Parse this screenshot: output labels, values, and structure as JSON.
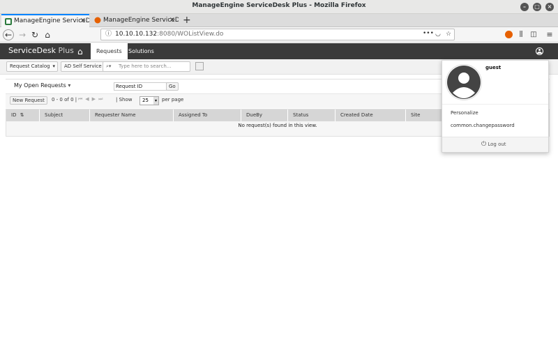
{
  "window": {
    "title": "ManageEngine ServiceDesk Plus - Mozilla Firefox"
  },
  "tabs": [
    {
      "label": "ManageEngine ServiceDe"
    },
    {
      "label": "ManageEngine ServiceDe"
    }
  ],
  "addressbar": {
    "host": "10.10.10.132",
    "path": ":8080/WOListView.do",
    "menu_dots": "•••"
  },
  "app": {
    "logo_main": "ServiceDesk",
    "logo_suffix": "Plus",
    "nav": [
      {
        "label": "Requests"
      },
      {
        "label": "Solutions"
      }
    ]
  },
  "toolbar": {
    "request_catalog": "Request Catalog",
    "ad_self_service": "AD Self Service",
    "search_placeholder": "Type here to search..."
  },
  "view": {
    "filter_label": "My Open Requests",
    "search_field_value": "Request ID",
    "go_label": "Go"
  },
  "pager": {
    "new_request": "New Request",
    "range": "0 - 0 of 0",
    "show_label": "Show",
    "per_page_value": "25",
    "per_page_label": "per page"
  },
  "grid": {
    "columns": [
      "ID",
      "Subject",
      "Requester Name",
      "Assigned To",
      "DueBy",
      "Status",
      "Created Date",
      "Site"
    ],
    "empty_message": "No request(s) found in this view."
  },
  "user_menu": {
    "username": "guest",
    "items": [
      "Personalize",
      "common.changepassword"
    ],
    "logout": "Log out"
  }
}
